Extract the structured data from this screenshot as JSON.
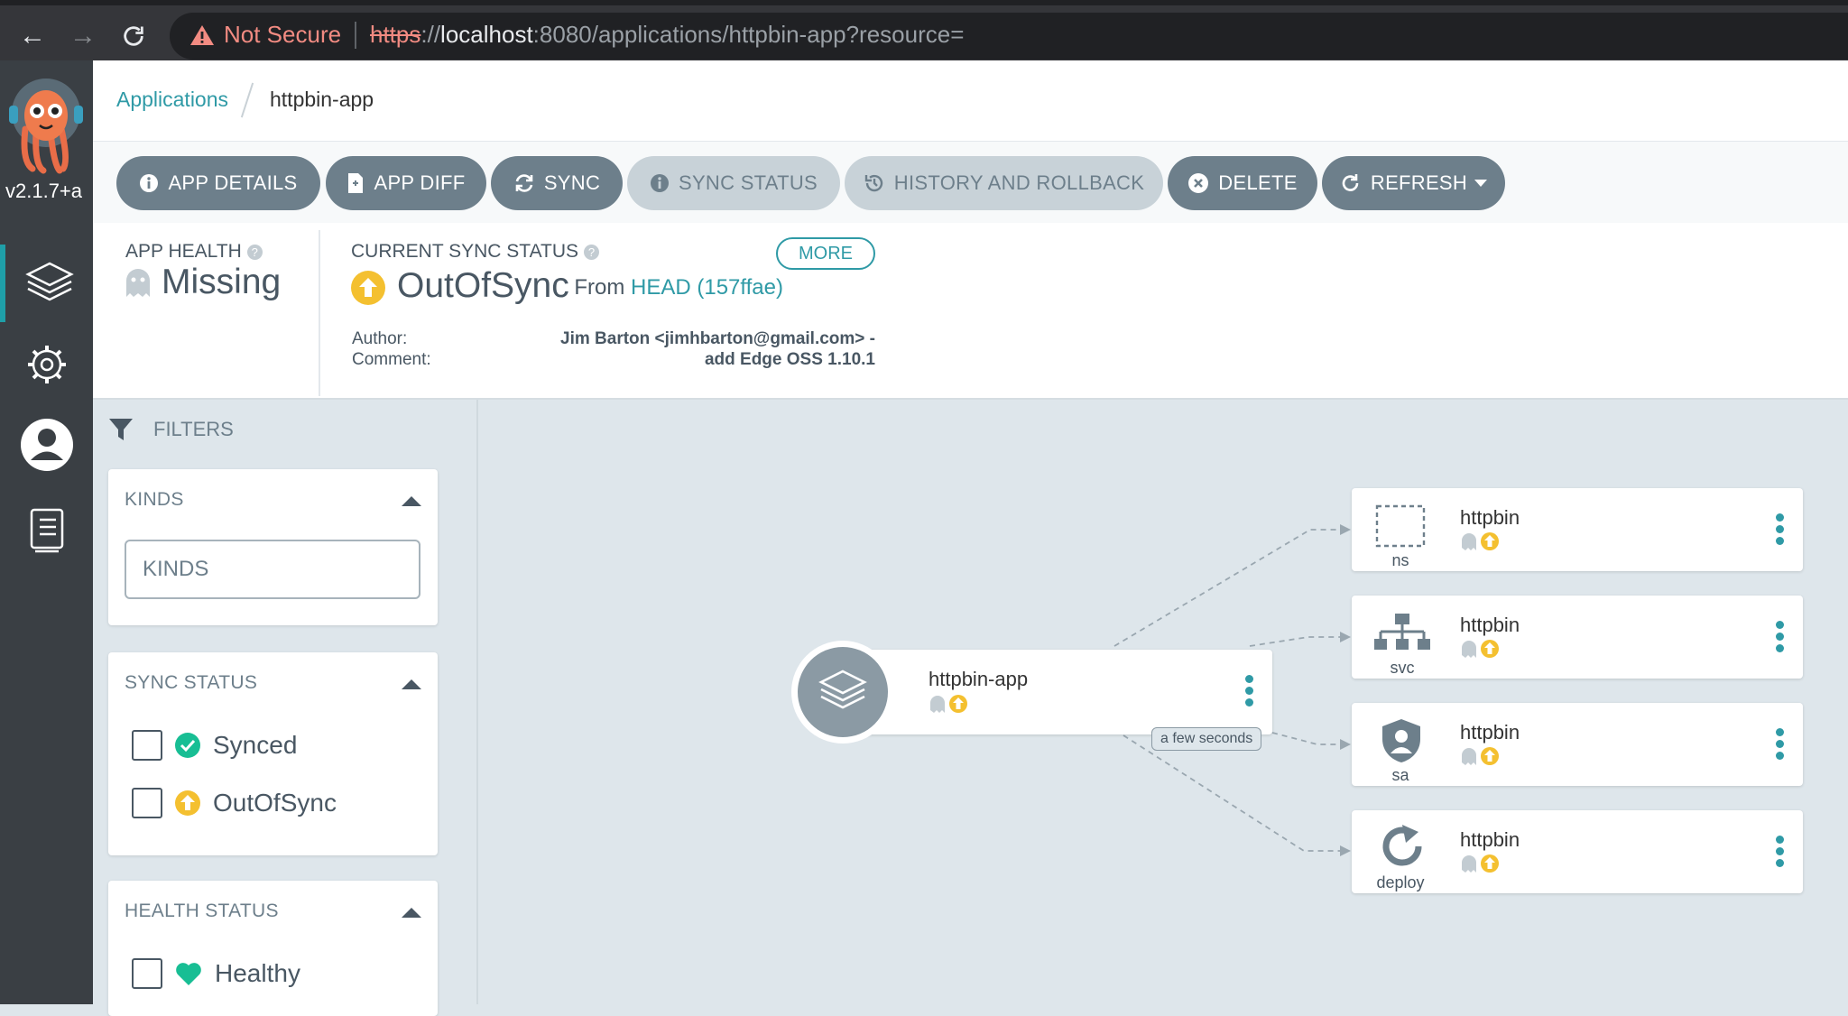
{
  "browser": {
    "warning_text": "Not Secure",
    "url_scheme": "https",
    "url_host": "localhost",
    "url_rest": ":8080/applications/httpbin-app?resource="
  },
  "rail": {
    "version": "v2.1.7+a"
  },
  "breadcrumb": {
    "parent": "Applications",
    "current": "httpbin-app"
  },
  "toolbar": {
    "app_details": "APP DETAILS",
    "app_diff": "APP DIFF",
    "sync": "SYNC",
    "sync_status": "SYNC STATUS",
    "history": "HISTORY AND ROLLBACK",
    "delete": "DELETE",
    "refresh": "REFRESH"
  },
  "status": {
    "health_label": "APP HEALTH",
    "health_value": "Missing",
    "sync_label": "CURRENT SYNC STATUS",
    "sync_value": "OutOfSync",
    "more": "MORE",
    "from_prefix": "From",
    "from_ref": "HEAD (157ffae)",
    "author_label": "Author:",
    "comment_label": "Comment:",
    "author_value": "Jim Barton <jimhbarton@gmail.com> -",
    "comment_value": "add Edge OSS 1.10.1"
  },
  "filters": {
    "title": "FILTERS",
    "kinds": {
      "title": "KINDS",
      "placeholder": "KINDS"
    },
    "sync_status": {
      "title": "SYNC STATUS",
      "options": [
        "Synced",
        "OutOfSync"
      ]
    },
    "health_status": {
      "title": "HEALTH STATUS",
      "options": [
        "Healthy"
      ]
    }
  },
  "graph": {
    "app_node": {
      "name": "httpbin-app"
    },
    "age_badge": "a few seconds",
    "resources": [
      {
        "name": "httpbin",
        "kind": "ns"
      },
      {
        "name": "httpbin",
        "kind": "svc"
      },
      {
        "name": "httpbin",
        "kind": "sa"
      },
      {
        "name": "httpbin",
        "kind": "deploy"
      }
    ]
  },
  "colors": {
    "accent": "#2f9aa6",
    "out_of_sync": "#f4c030",
    "synced": "#18be94",
    "healthy": "#18be94",
    "button": "#6d7f8b"
  }
}
